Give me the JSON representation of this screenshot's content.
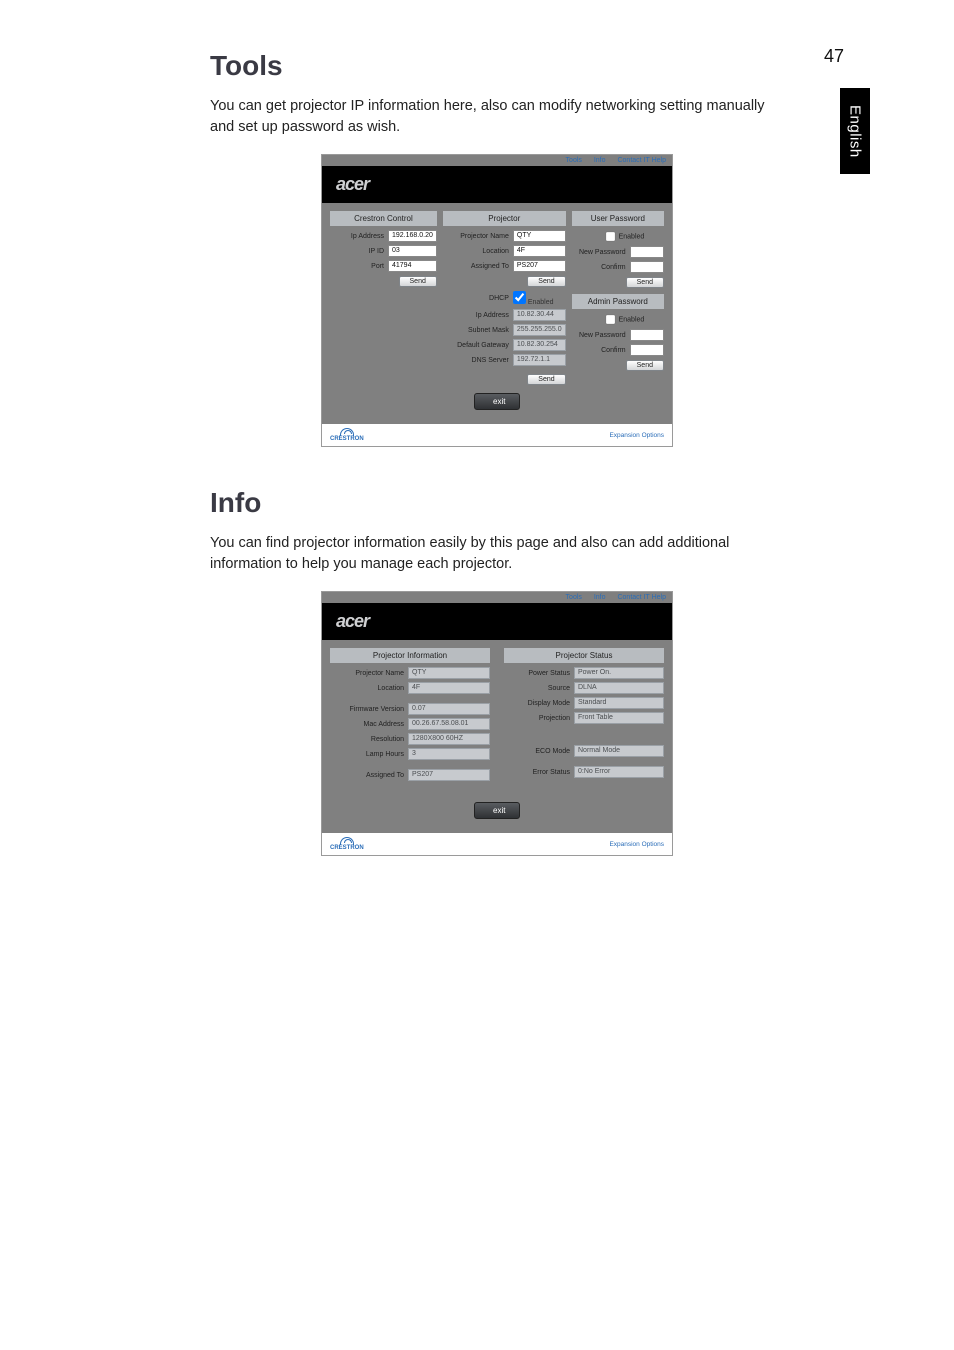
{
  "page_number": "47",
  "side_tab": "English",
  "section_tools": {
    "heading": "Tools",
    "lede": "You can get projector IP information here, also can modify networking setting manually and set up password as wish."
  },
  "section_info": {
    "heading": "Info",
    "lede": "You can find projector information easily by this page and also can add additional information to help you manage each projector."
  },
  "shot_common": {
    "brand": "acer",
    "topbar": {
      "tools": "Tools",
      "info": "Info",
      "contact": "Contact IT Help"
    },
    "exit": "exit",
    "expansion": "Expansion Options",
    "crestron": "CRESTRON"
  },
  "tools_shot": {
    "heads": {
      "crestron": "Crestron Control",
      "projector": "Projector",
      "userpw": "User Password",
      "adminpw": "Admin Password"
    },
    "labels": {
      "ip_address": "Ip Address",
      "ip_id": "IP ID",
      "port": "Port",
      "send": "Send",
      "proj_name": "Projector Name",
      "location": "Location",
      "assigned": "Assigned To",
      "dhcp": "DHCP",
      "dhcp_enabled": "Enabled",
      "subnet": "Subnet Mask",
      "gateway": "Default Gateway",
      "dns": "DNS Server",
      "enabled": "Enabled",
      "newpw": "New Password",
      "confirm": "Confirm"
    },
    "values": {
      "crestron_ip": "192.168.0.20",
      "ip_id": "03",
      "port": "41794",
      "proj_name": "QTY",
      "location": "4F",
      "assigned": "PS207",
      "net_ip": "10.82.30.44",
      "subnet": "255.255.255.0",
      "gateway": "10.82.30.254",
      "dns": "192.72.1.1"
    }
  },
  "info_shot": {
    "heads": {
      "left": "Projector Information",
      "right": "Projector Status"
    },
    "labels": {
      "proj_name": "Projector Name",
      "location": "Location",
      "fw": "Firmware Version",
      "mac": "Mac Address",
      "res": "Resolution",
      "lamp": "Lamp Hours",
      "assigned": "Assigned To",
      "power": "Power Status",
      "source": "Source",
      "disp": "Display Mode",
      "projn": "Projection",
      "eco": "ECO Mode",
      "err": "Error Status"
    },
    "values": {
      "proj_name": "QTY",
      "location": "4F",
      "fw": "0.07",
      "mac": "00.26.67.58.08.01",
      "res": "1280X800 60HZ",
      "lamp": "3",
      "assigned": "PS207",
      "power": "Power On.",
      "source": "DLNA",
      "disp": "Standard",
      "projn": "Front Table",
      "eco": "Normal Mode",
      "err": "0:No Error"
    }
  }
}
